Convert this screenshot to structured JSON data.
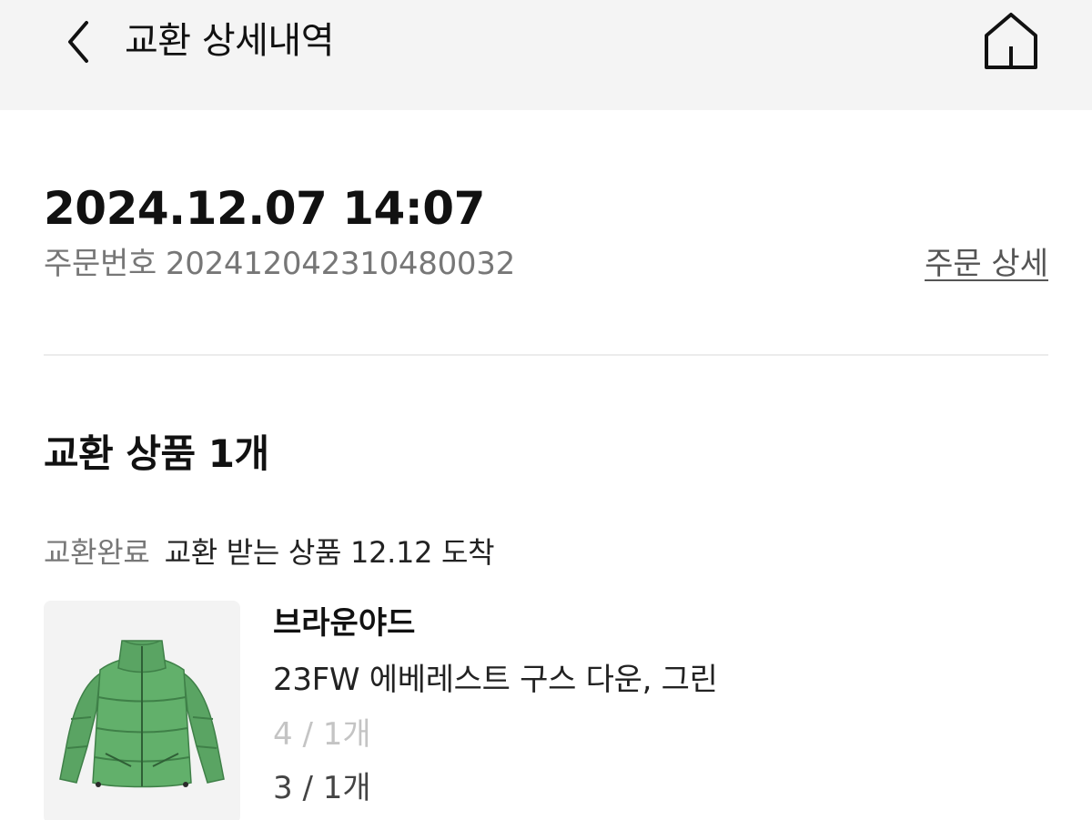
{
  "header": {
    "title": "교환 상세내역",
    "back_icon": "chevron-left-icon",
    "home_icon": "home-icon"
  },
  "order": {
    "datetime": "2024.12.07 14:07",
    "number_label": "주문번호",
    "number": "20241204231048 0032",
    "number_value": "2024120423104800 32",
    "detail_link": "주문 상세"
  },
  "exchange": {
    "section_title": "교환 상품 1개",
    "status": "교환완료",
    "status_info": "교환 받는 상품 12.12 도착",
    "product": {
      "brand": "브라운야드",
      "name": "23FW 에베레스트 구스 다운, 그린",
      "previous_option": "4 / 1개",
      "new_option": "3 / 1개",
      "image_icon": "green-down-jacket-image"
    }
  },
  "colors": {
    "header_bg": "#f4f4f4",
    "text_primary": "#111111",
    "text_secondary": "#777777",
    "text_disabled": "#c4c4c4",
    "jacket_green": "#5faa68"
  }
}
